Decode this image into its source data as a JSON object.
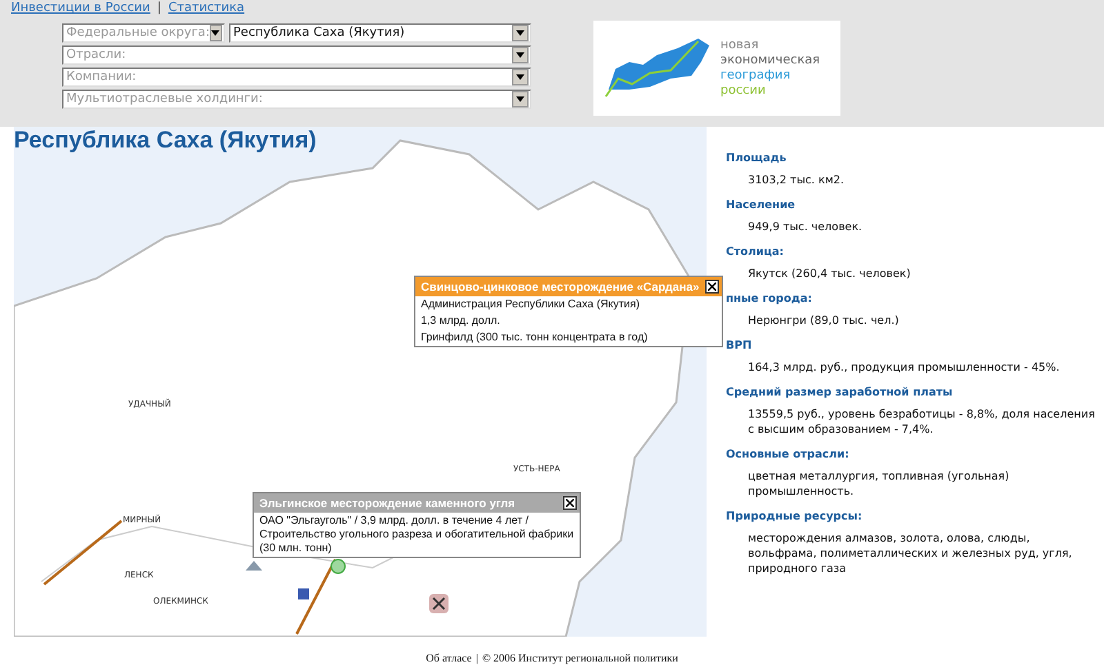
{
  "top_links": [
    "Инвестиции в России",
    "Статистика"
  ],
  "top_links_separator": "|",
  "filters": [
    {
      "placeholder": "Федеральные округа:",
      "value": "Республика Саха (Якутия)"
    },
    {
      "placeholder": "Отрасли:"
    },
    {
      "placeholder": "Компании:"
    },
    {
      "placeholder": "Мультиотраслевые холдинги:"
    }
  ],
  "logo": {
    "lines": [
      "новая",
      "экономическая",
      "география",
      "россии"
    ]
  },
  "map": {
    "title": "Республика Саха (Якутия)",
    "cities": [
      "УДАЧНЫЙ",
      "МИРНЫЙ",
      "ЛЕНСК",
      "ОЛЕКМИНСК",
      "УСТЬ-НЕРА"
    ],
    "popups": [
      {
        "kind": "active",
        "title": "Свинцово-цинковое месторождение «Сардана»",
        "lines": [
          "Администрация Республики Саха (Якутия)",
          "1,3 млрд. долл.",
          "Гринфилд (300 тыс. тонн концентрата в год)"
        ]
      },
      {
        "kind": "inactive",
        "title": "Эльгинское месторождение каменного угля",
        "lines": [
          "ОАО \"Эльгауголь\" / 3,9 млрд. долл. в течение 4 лет / Строительство угольного разреза и обогатительной фабрики (30 млн. тонн)"
        ]
      }
    ]
  },
  "facts": [
    {
      "label": "Площадь",
      "text": "3103,2 тыс. км2."
    },
    {
      "label": "Население",
      "text": "949,9 тыс. человек."
    },
    {
      "label": "Столица:",
      "text": "Якутск (260,4 тыс. человек)"
    },
    {
      "label": "пные города:",
      "text": "Нерюнгри (89,0 тыс. чел.)"
    },
    {
      "label": "ВРП",
      "text": "164,3 млрд. руб., продукция промышленности - 45%."
    },
    {
      "label": "Средний размер заработной платы",
      "text": "13559,5 руб., уровень безработицы - 8,8%, доля населения с высшим образованием - 7,4%."
    },
    {
      "label": "Основные отрасли:",
      "text": "цветная металлургия, топливная (угольная) промышленность."
    },
    {
      "label": "Природные ресурсы:",
      "text": "месторождения алмазов, золота, олова, слюды, вольфрама, полиметаллических и железных руд, угля, природного газа"
    }
  ],
  "footer": {
    "link": "Об атласе",
    "separator": "|",
    "copyright": "© 2006 Институт региональной политики"
  }
}
